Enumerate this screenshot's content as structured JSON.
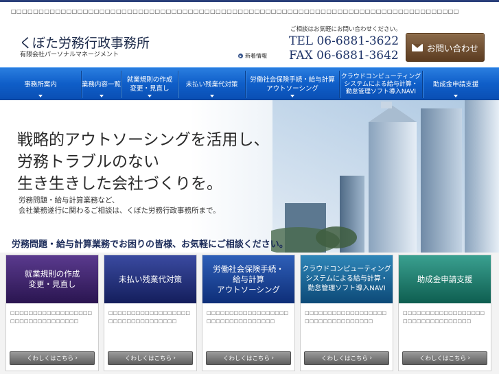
{
  "top_bar": {
    "text": "□□□□□□□□□□□□□□□□□□□□□□□□□□□□□□□□□□□□□□□□□□□□□□□□□□□□□□□□□□□□□□□□□□□□□□□□□□□□□□□□□"
  },
  "header": {
    "logo_main": "くぼた労務行政事務所",
    "logo_sub": "有限会社パーソナルマネージメント",
    "news_label": "新着情報",
    "contact_note": "ご相談はお気軽にお問い合わせください。",
    "tel": "TEL 06-6881-3622",
    "fax": "FAX 06-6881-3642",
    "contact_button": "お問い合わせ"
  },
  "nav": {
    "items": [
      {
        "line1": "事務所案内",
        "line2": ""
      },
      {
        "line1": "業務内容一覧",
        "line2": ""
      },
      {
        "line1": "就業規則の作成",
        "line2": "変更・見直し"
      },
      {
        "line1": "未払い残業代対策",
        "line2": ""
      },
      {
        "line1": "労働社会保険手続・給与計算",
        "line2": "アウトソーシング"
      },
      {
        "line1": "クラウドコンピューティング",
        "line2": "システムによる給与計算・",
        "line3": "勤怠管理ソフト導入NAVI"
      },
      {
        "line1": "助成金申請支援",
        "line2": ""
      }
    ]
  },
  "hero": {
    "title_lines": [
      "戦略的アウトソーシングを活用し、",
      "労務トラブルのない",
      "生き生きした会社づくりを。"
    ],
    "body_lines": [
      "労務問題・給与計算業務など、",
      "会社業務遂行に関わるご相談は、くぼた労務行政事務所まで。"
    ],
    "tagline": "労務問題・給与計算業務でお困りの皆様、お気軽にご相談ください。"
  },
  "cards": [
    {
      "title_lines": [
        "就業規則の作成",
        "変更・見直し"
      ],
      "text": "□□□□□□□□□□□□□□□□□□□□□□□□□□□□□□□□□",
      "button": "くわしくはこちら",
      "color_top": "#5a3a8e",
      "color_bottom": "#2a1550"
    },
    {
      "title_lines": [
        "未払い残業代対策"
      ],
      "text": "□□□□□□□□□□□□□□□□□□□□□□□□□□□□□□□□□",
      "button": "くわしくはこちら",
      "color_top": "#3a4aa0",
      "color_bottom": "#141e5c"
    },
    {
      "title_lines": [
        "労働社会保険手続・",
        "給与計算",
        "アウトソーシング"
      ],
      "text": "□□□□□□□□□□□□□□□□□□□□□□□□□□□□□□□□□",
      "button": "くわしくはこちら",
      "color_top": "#2e5fb8",
      "color_bottom": "#0e2e78"
    },
    {
      "title_lines": [
        "クラウドコンピューティング",
        "システムによる給与計算・",
        "勤怠管理ソフト導入NAVI"
      ],
      "text": "□□□□□□□□□□□□□□□□□□□□□□□□□□□□□□□□□",
      "button": "くわしくはこちら",
      "color_top": "#2f86b8",
      "color_bottom": "#0d4a78"
    },
    {
      "title_lines": [
        "助成金申請支援"
      ],
      "text": "□□□□□□□□□□□□□□□□□□□□□□□□□□□□□□□□□",
      "button": "くわしくはこちら",
      "color_top": "#3aa090",
      "color_bottom": "#0e5e50"
    }
  ],
  "colors": {
    "nav_blue": "#0f5ec8",
    "brand_navy": "#1f3468",
    "contact_brown": "#6c4c2e"
  },
  "icons": {
    "contact": "mail-icon",
    "news": "bullet-arrow-icon",
    "nav": "chevron-down-icon",
    "card_button": "chevron-right-icon"
  }
}
